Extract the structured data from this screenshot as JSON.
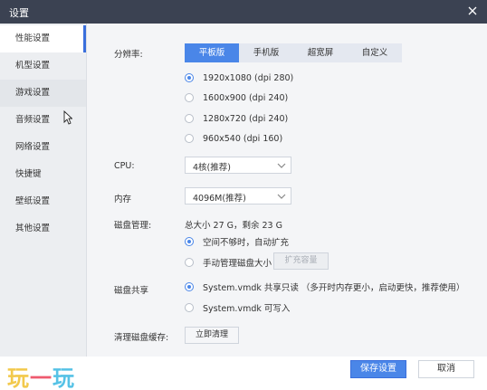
{
  "window": {
    "title": "设置"
  },
  "sidebar": {
    "items": [
      {
        "label": "性能设置"
      },
      {
        "label": "机型设置"
      },
      {
        "label": "游戏设置"
      },
      {
        "label": "音频设置"
      },
      {
        "label": "网络设置"
      },
      {
        "label": "快捷键"
      },
      {
        "label": "壁纸设置"
      },
      {
        "label": "其他设置"
      }
    ],
    "active_index": 0
  },
  "resolution": {
    "label": "分辨率:",
    "modes": [
      "平板版",
      "手机版",
      "超宽屏",
      "自定义"
    ],
    "active_mode": "平板版",
    "options": [
      "1920x1080  (dpi 280)",
      "1600x900  (dpi 240)",
      "1280x720  (dpi 240)",
      "960x540  (dpi 160)"
    ],
    "selected": "1920x1080  (dpi 280)"
  },
  "cpu": {
    "label": "CPU:",
    "value": "4核(推荐)"
  },
  "memory": {
    "label": "内存",
    "value": "4096M(推荐)"
  },
  "disk": {
    "label": "磁盘管理:",
    "summary": "总大小 27 G，剩余 23 G",
    "options": [
      "空间不够时，自动扩充",
      "手动管理磁盘大小"
    ],
    "selected": "空间不够时，自动扩充",
    "expand_button": "扩充容量"
  },
  "disk_share": {
    "label": "磁盘共享",
    "options": [
      "System.vmdk 共享只读  （多开时内存更小，启动更快，推荐使用）",
      "System.vmdk 可写入"
    ],
    "selected": "System.vmdk 共享只读  （多开时内存更小，启动更快，推荐使用）"
  },
  "cache": {
    "label": "清理磁盘缓存:",
    "button": "立即清理"
  },
  "footer": {
    "logo": [
      "玩",
      "一",
      "玩"
    ],
    "save_label": "保存设置",
    "cancel_label": "取消"
  },
  "colors": {
    "accent": "#4a86e8",
    "titlebar": "#3b4252"
  }
}
